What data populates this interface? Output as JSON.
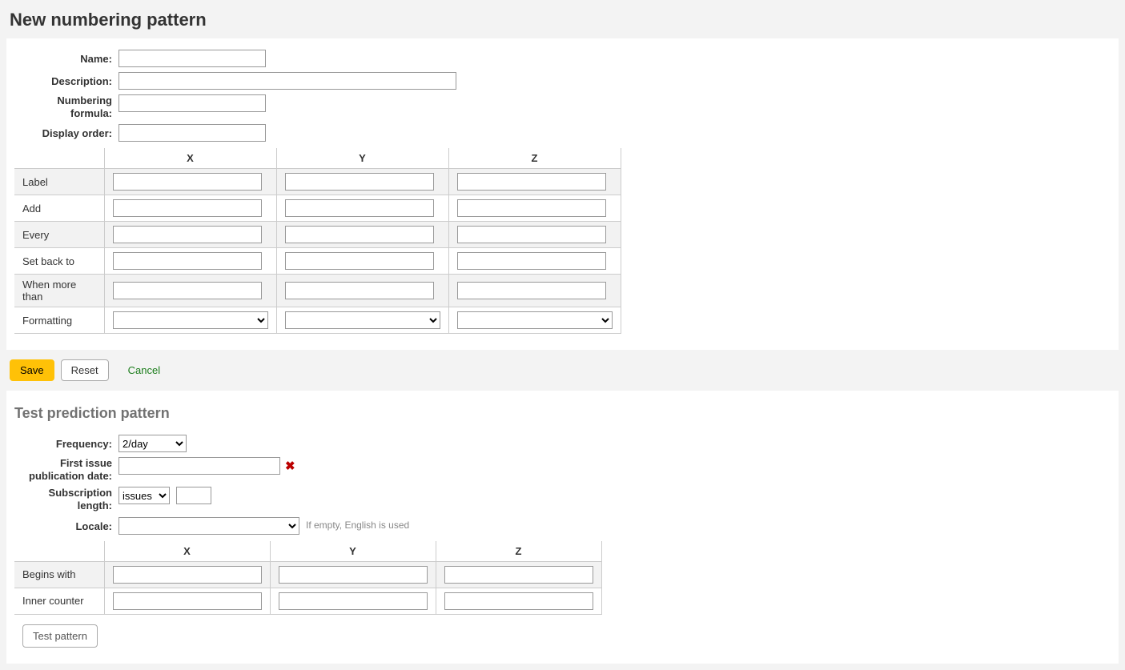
{
  "page_title": "New numbering pattern",
  "form1": {
    "name_label": "Name:",
    "name_value": "",
    "description_label": "Description:",
    "description_value": "",
    "formula_label": "Numbering formula:",
    "formula_value": "",
    "display_order_label": "Display order:",
    "display_order_value": ""
  },
  "grid": {
    "col_x": "X",
    "col_y": "Y",
    "col_z": "Z",
    "rows": {
      "label": "Label",
      "add": "Add",
      "every": "Every",
      "setback": "Set back to",
      "whenmore": "When more than",
      "formatting": "Formatting"
    },
    "values": {
      "label_x": "",
      "label_y": "",
      "label_z": "",
      "add_x": "",
      "add_y": "",
      "add_z": "",
      "every_x": "",
      "every_y": "",
      "every_z": "",
      "setback_x": "",
      "setback_y": "",
      "setback_z": "",
      "whenmore_x": "",
      "whenmore_y": "",
      "whenmore_z": "",
      "formatting_x": "",
      "formatting_y": "",
      "formatting_z": ""
    }
  },
  "actions": {
    "save": "Save",
    "reset": "Reset",
    "cancel": "Cancel"
  },
  "panel2": {
    "legend": "Test prediction pattern",
    "frequency_label": "Frequency:",
    "frequency_value": "2/day",
    "first_issue_label": "First issue publication date:",
    "first_issue_value": "",
    "sub_length_label": "Subscription length:",
    "sub_length_unit": "issues",
    "sub_length_value": "",
    "locale_label": "Locale:",
    "locale_value": "",
    "locale_hint": "If empty, English is used"
  },
  "grid2": {
    "col_x": "X",
    "col_y": "Y",
    "col_z": "Z",
    "rows": {
      "begins": "Begins with",
      "inner": "Inner counter"
    },
    "values": {
      "begins_x": "",
      "begins_y": "",
      "begins_z": "",
      "inner_x": "",
      "inner_y": "",
      "inner_z": ""
    }
  },
  "test_btn": "Test pattern"
}
